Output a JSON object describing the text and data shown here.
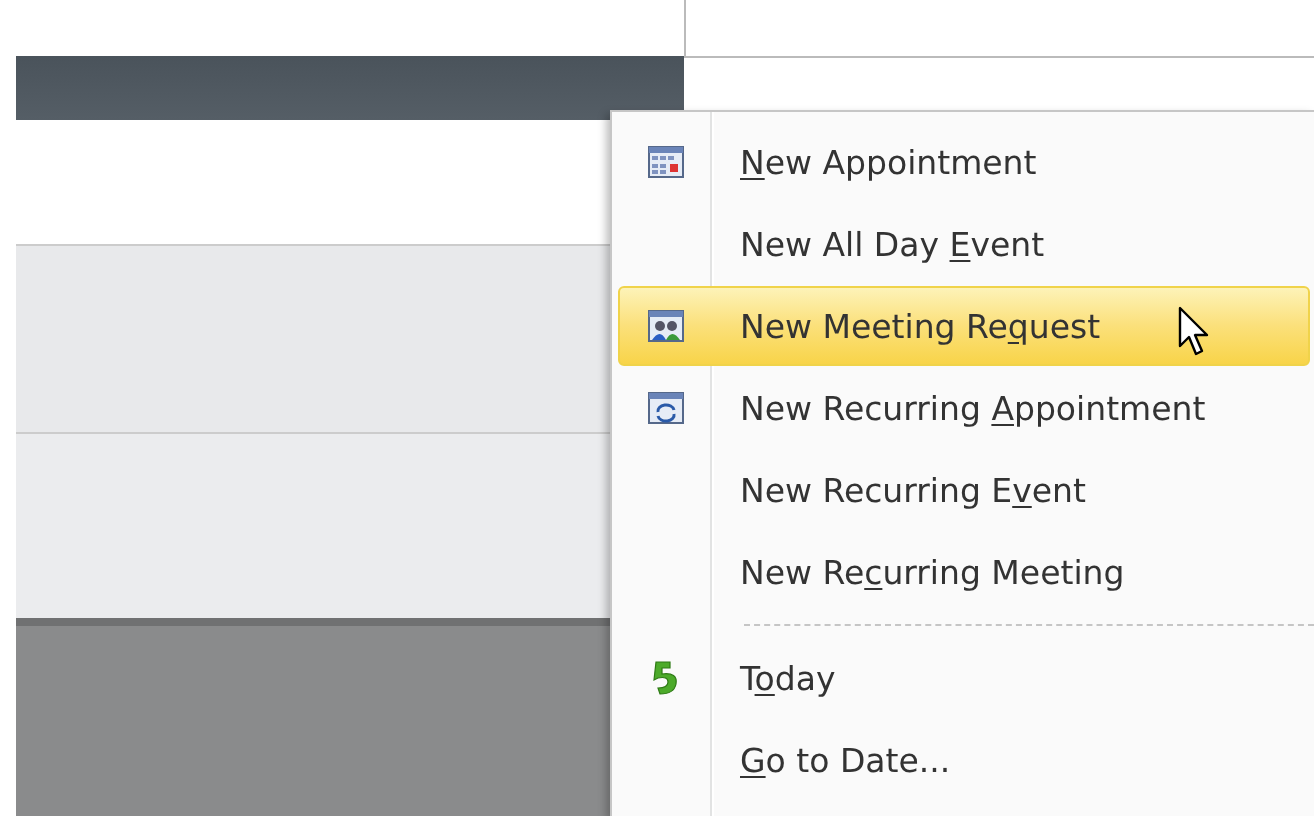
{
  "menu": {
    "items": [
      {
        "kind": "calendar",
        "access_key": "N",
        "text_after": "ew Appointment",
        "selected": false
      },
      {
        "kind": "none",
        "text_before": "New All Day ",
        "access_key": "E",
        "text_after": "vent",
        "selected": false
      },
      {
        "kind": "meeting",
        "text_before": "New Meeting Re",
        "access_key": "q",
        "text_after": "uest",
        "selected": true
      },
      {
        "kind": "recurring",
        "text_before": "New Recurring ",
        "access_key": "A",
        "text_after": "ppointment",
        "selected": false
      },
      {
        "kind": "none",
        "text_before": "New Recurring E",
        "access_key": "v",
        "text_after": "ent",
        "selected": false
      },
      {
        "kind": "none",
        "text_before": "New Re",
        "access_key": "c",
        "text_after": "urring Meeting",
        "selected": false
      },
      {
        "kind": "separator"
      },
      {
        "kind": "today",
        "text_before": "T",
        "access_key": "o",
        "text_after": "day",
        "selected": false
      },
      {
        "kind": "none",
        "access_key": "G",
        "text_after": "o to Date...",
        "selected": false
      }
    ]
  }
}
